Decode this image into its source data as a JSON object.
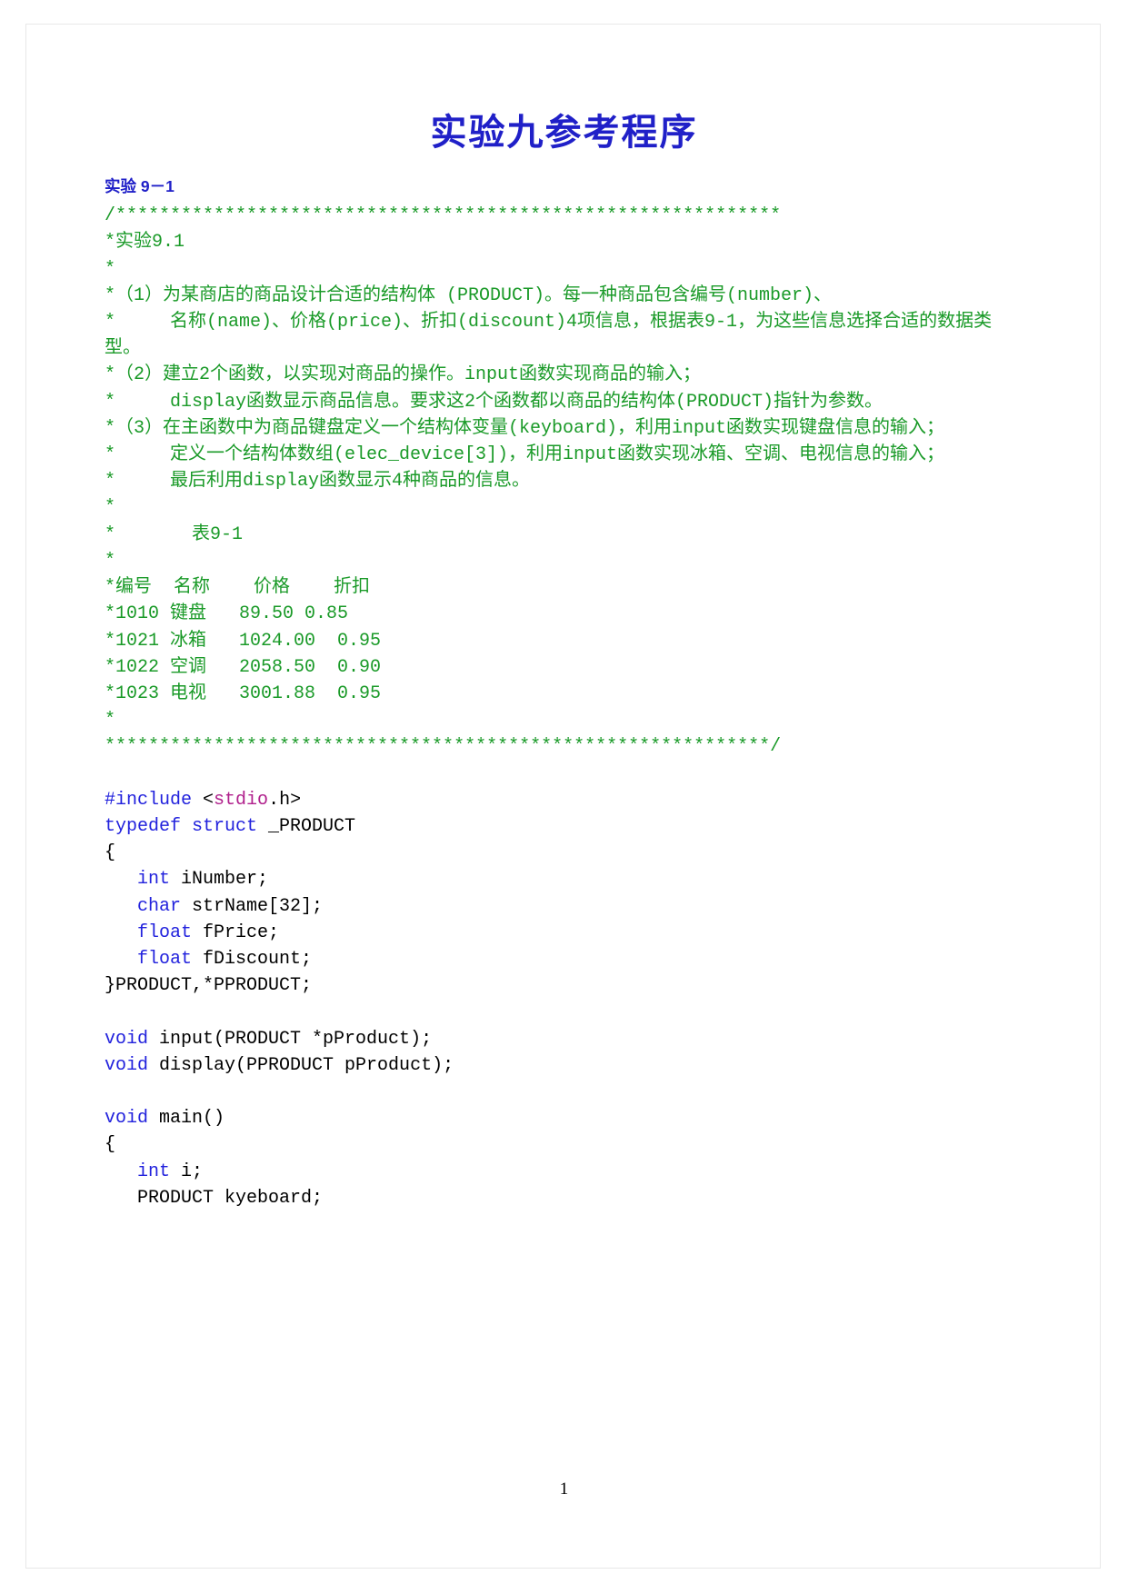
{
  "document": {
    "title": "实验九参考程序",
    "section_heading": "实验 9－1",
    "page_number": "1",
    "colors": {
      "title": "#2020c8",
      "heading": "#2020c8",
      "comment": "#1a9a28",
      "keyword": "#2222dd",
      "header_name": "#b0208c",
      "plain": "#000000",
      "page_background": "#ffffff"
    }
  },
  "code": {
    "language": "c",
    "lines": [
      {
        "segments": [
          {
            "t": "/*************************************************************",
            "c": "cmt"
          }
        ]
      },
      {
        "segments": [
          {
            "t": "*实验9.1",
            "c": "cmt"
          }
        ]
      },
      {
        "segments": [
          {
            "t": "*",
            "c": "cmt"
          }
        ]
      },
      {
        "segments": [
          {
            "t": "*（1）为某商店的商品设计合适的结构体 (PRODUCT)。每一种商品包含编号(number)、",
            "c": "cmt"
          }
        ]
      },
      {
        "segments": [
          {
            "t": "*     名称(name)、价格(price)、折扣(discount)4项信息，根据表9-1，为这些信息选择合适的数据类型。",
            "c": "cmt"
          }
        ]
      },
      {
        "segments": [
          {
            "t": "*（2）建立2个函数，以实现对商品的操作。input函数实现商品的输入；",
            "c": "cmt"
          }
        ]
      },
      {
        "segments": [
          {
            "t": "*     display函数显示商品信息。要求这2个函数都以商品的结构体(PRODUCT)指针为参数。",
            "c": "cmt"
          }
        ]
      },
      {
        "segments": [
          {
            "t": "*（3）在主函数中为商品键盘定义一个结构体变量(keyboard)，利用input函数实现键盘信息的输入；",
            "c": "cmt"
          }
        ]
      },
      {
        "segments": [
          {
            "t": "*     定义一个结构体数组(elec_device[3])，利用input函数实现冰箱、空调、电视信息的输入；",
            "c": "cmt"
          }
        ]
      },
      {
        "segments": [
          {
            "t": "*     最后利用display函数显示4种商品的信息。",
            "c": "cmt"
          }
        ]
      },
      {
        "segments": [
          {
            "t": "*",
            "c": "cmt"
          }
        ]
      },
      {
        "segments": [
          {
            "t": "*       表9-1",
            "c": "cmt"
          }
        ]
      },
      {
        "segments": [
          {
            "t": "*",
            "c": "cmt"
          }
        ]
      },
      {
        "segments": [
          {
            "t": "*编号  名称    价格    折扣",
            "c": "cmt"
          }
        ]
      },
      {
        "segments": [
          {
            "t": "*1010 键盘   89.50 0.85",
            "c": "cmt"
          }
        ]
      },
      {
        "segments": [
          {
            "t": "*1021 冰箱   1024.00  0.95",
            "c": "cmt"
          }
        ]
      },
      {
        "segments": [
          {
            "t": "*1022 空调   2058.50  0.90",
            "c": "cmt"
          }
        ]
      },
      {
        "segments": [
          {
            "t": "*1023 电视   3001.88  0.95",
            "c": "cmt"
          }
        ]
      },
      {
        "segments": [
          {
            "t": "*",
            "c": "cmt"
          }
        ]
      },
      {
        "segments": [
          {
            "t": "*************************************************************/",
            "c": "cmt"
          }
        ]
      },
      {
        "segments": [
          {
            "t": "",
            "c": "pl"
          }
        ]
      },
      {
        "segments": [
          {
            "t": "#include ",
            "c": "pp"
          },
          {
            "t": "<",
            "c": "pl"
          },
          {
            "t": "stdio",
            "c": "hdr"
          },
          {
            "t": ".h>",
            "c": "pl"
          }
        ]
      },
      {
        "segments": [
          {
            "t": "typedef struct ",
            "c": "kw"
          },
          {
            "t": "_PRODUCT",
            "c": "pl"
          }
        ]
      },
      {
        "segments": [
          {
            "t": "{",
            "c": "pl"
          }
        ]
      },
      {
        "segments": [
          {
            "t": "   ",
            "c": "pl"
          },
          {
            "t": "int",
            "c": "kw"
          },
          {
            "t": " iNumber;",
            "c": "pl"
          }
        ]
      },
      {
        "segments": [
          {
            "t": "   ",
            "c": "pl"
          },
          {
            "t": "char",
            "c": "kw"
          },
          {
            "t": " strName[32];",
            "c": "pl"
          }
        ]
      },
      {
        "segments": [
          {
            "t": "   ",
            "c": "pl"
          },
          {
            "t": "float",
            "c": "kw"
          },
          {
            "t": " fPrice;",
            "c": "pl"
          }
        ]
      },
      {
        "segments": [
          {
            "t": "   ",
            "c": "pl"
          },
          {
            "t": "float",
            "c": "kw"
          },
          {
            "t": " fDiscount;",
            "c": "pl"
          }
        ]
      },
      {
        "segments": [
          {
            "t": "}PRODUCT,*PPRODUCT;",
            "c": "pl"
          }
        ]
      },
      {
        "segments": [
          {
            "t": "",
            "c": "pl"
          }
        ]
      },
      {
        "segments": [
          {
            "t": "void",
            "c": "kw"
          },
          {
            "t": " input(PRODUCT *pProduct);",
            "c": "pl"
          }
        ]
      },
      {
        "segments": [
          {
            "t": "void",
            "c": "kw"
          },
          {
            "t": " display(PPRODUCT pProduct);",
            "c": "pl"
          }
        ]
      },
      {
        "segments": [
          {
            "t": "",
            "c": "pl"
          }
        ]
      },
      {
        "segments": [
          {
            "t": "void",
            "c": "kw"
          },
          {
            "t": " main()",
            "c": "pl"
          }
        ]
      },
      {
        "segments": [
          {
            "t": "{",
            "c": "pl"
          }
        ]
      },
      {
        "segments": [
          {
            "t": "   ",
            "c": "pl"
          },
          {
            "t": "int",
            "c": "kw"
          },
          {
            "t": " i;",
            "c": "pl"
          }
        ]
      },
      {
        "segments": [
          {
            "t": "   PRODUCT kyeboard;",
            "c": "pl"
          }
        ]
      }
    ]
  },
  "product_table": {
    "caption": "表9-1",
    "headers": [
      "编号",
      "名称",
      "价格",
      "折扣"
    ],
    "rows": [
      [
        "1010",
        "键盘",
        "89.50",
        "0.85"
      ],
      [
        "1021",
        "冰箱",
        "1024.00",
        "0.95"
      ],
      [
        "1022",
        "空调",
        "2058.50",
        "0.90"
      ],
      [
        "1023",
        "电视",
        "3001.88",
        "0.95"
      ]
    ]
  }
}
